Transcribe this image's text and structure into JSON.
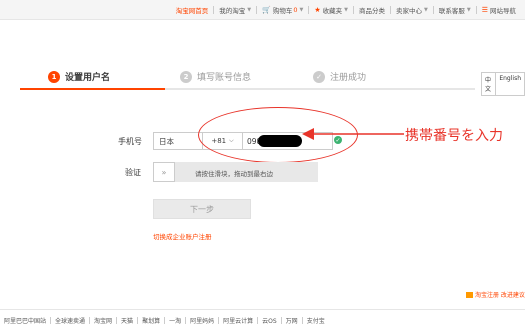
{
  "top_nav": {
    "home": "淘宝网首页",
    "my_taobao": "我的淘宝",
    "cart": "购物车",
    "cart_count": "0",
    "favorites": "收藏夹",
    "categories": "商品分类",
    "seller_center": "卖家中心",
    "contact": "联系客服",
    "site_nav": "网站导航"
  },
  "steps": [
    {
      "number": "1",
      "label": "设置用户名"
    },
    {
      "number": "2",
      "label": "填写账号信息"
    },
    {
      "number": "✓",
      "label": "注册成功"
    }
  ],
  "language": {
    "zh": "中文",
    "en": "English"
  },
  "form": {
    "phone_label": "手机号",
    "country": "日本",
    "country_code": "+81",
    "phone_value": "090",
    "verify_label": "验证",
    "slider_text": "请按住滑块，拖动到最右边",
    "slider_handle": "»",
    "next_button": "下一步",
    "enterprise_link": "切换成企业账户注册"
  },
  "annotation": {
    "text": "携帯番号を入力",
    "color": "#e8342a"
  },
  "corner_badge": "淘宝注册 改进建议",
  "footer_links": [
    "阿里巴巴中国站",
    "全球速卖通",
    "淘宝网",
    "天猫",
    "聚划算",
    "一淘",
    "阿里妈妈",
    "阿里云计算",
    "云OS",
    "万网",
    "支付宝"
  ],
  "colors": {
    "accent": "#ff4400",
    "inactive": "#cccccc",
    "success": "#3cb371"
  }
}
